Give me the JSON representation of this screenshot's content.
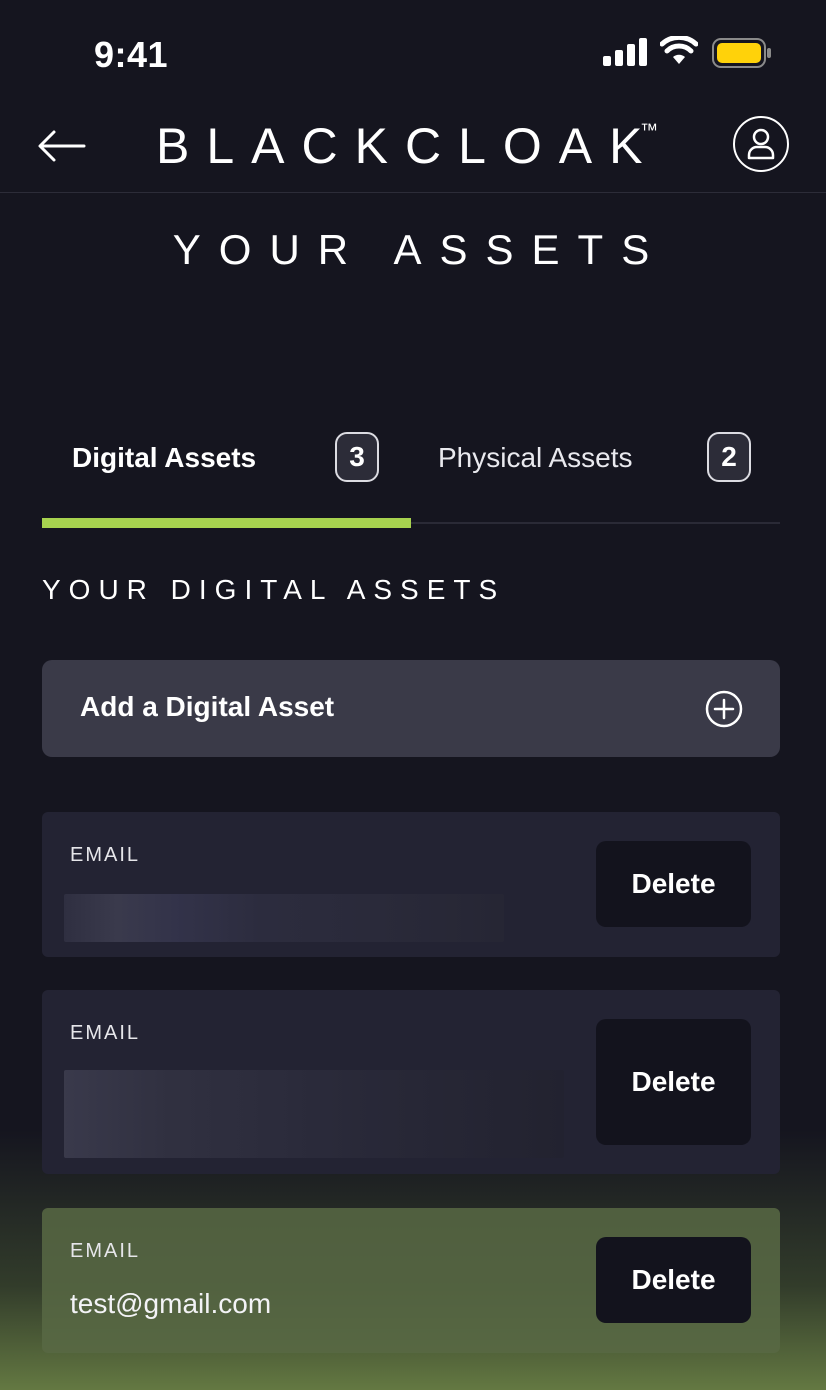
{
  "status_bar": {
    "time": "9:41"
  },
  "header": {
    "brand": "BLACKCLOAK",
    "trademark": "™"
  },
  "page_title": "YOUR ASSETS",
  "tabs": [
    {
      "label": "Digital Assets",
      "count": "3",
      "active": true
    },
    {
      "label": "Physical Assets",
      "count": "2",
      "active": false
    }
  ],
  "section_label": "YOUR DIGITAL ASSETS",
  "add_asset": {
    "label": "Add a Digital Asset"
  },
  "assets": [
    {
      "type": "EMAIL",
      "value": "",
      "redacted": true,
      "delete_label": "Delete"
    },
    {
      "type": "EMAIL",
      "value": "",
      "redacted": true,
      "delete_label": "Delete"
    },
    {
      "type": "EMAIL",
      "value": "test@gmail.com",
      "redacted": false,
      "delete_label": "Delete"
    }
  ],
  "colors": {
    "background": "#15151f",
    "accent": "#a7d24f",
    "card": "#232333",
    "button": "#13131d"
  },
  "icons": [
    "signal-icon",
    "wifi-icon",
    "battery-icon",
    "back-arrow-icon",
    "profile-icon",
    "plus-circle-icon"
  ]
}
